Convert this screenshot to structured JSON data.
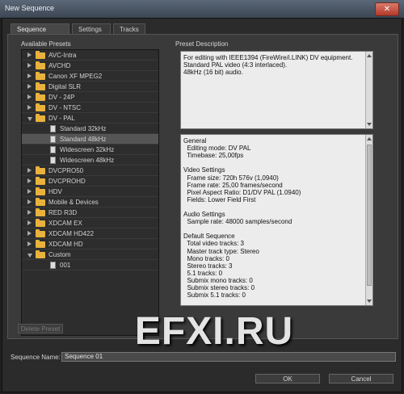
{
  "window": {
    "title": "New Sequence",
    "close_glyph": "✕"
  },
  "tabs": [
    "Sequence Presets",
    "Settings",
    "Tracks"
  ],
  "presets": {
    "group_label": "Available Presets",
    "items": [
      {
        "label": "AVC-Intra",
        "type": "folder",
        "expanded": false
      },
      {
        "label": "AVCHD",
        "type": "folder",
        "expanded": false
      },
      {
        "label": "Canon XF MPEG2",
        "type": "folder",
        "expanded": false
      },
      {
        "label": "Digital SLR",
        "type": "folder",
        "expanded": false
      },
      {
        "label": "DV - 24P",
        "type": "folder",
        "expanded": false
      },
      {
        "label": "DV - NTSC",
        "type": "folder",
        "expanded": false
      },
      {
        "label": "DV - PAL",
        "type": "folder",
        "expanded": true
      },
      {
        "label": "Standard 32kHz",
        "type": "preset"
      },
      {
        "label": "Standard 48kHz",
        "type": "preset",
        "selected": true
      },
      {
        "label": "Widescreen 32kHz",
        "type": "preset"
      },
      {
        "label": "Widescreen 48kHz",
        "type": "preset"
      },
      {
        "label": "DVCPRO50",
        "type": "folder",
        "expanded": false
      },
      {
        "label": "DVCPROHD",
        "type": "folder",
        "expanded": false
      },
      {
        "label": "HDV",
        "type": "folder",
        "expanded": false
      },
      {
        "label": "Mobile & Devices",
        "type": "folder",
        "expanded": false
      },
      {
        "label": "RED R3D",
        "type": "folder",
        "expanded": false
      },
      {
        "label": "XDCAM EX",
        "type": "folder",
        "expanded": false
      },
      {
        "label": "XDCAM HD422",
        "type": "folder",
        "expanded": false
      },
      {
        "label": "XDCAM HD",
        "type": "folder",
        "expanded": false
      },
      {
        "label": "Custom",
        "type": "folder",
        "expanded": true
      },
      {
        "label": "001",
        "type": "preset"
      }
    ]
  },
  "description": {
    "group_label": "Preset Description",
    "text": [
      "For editing with IEEE1394 (FireWire/i.LINK) DV equipment.",
      "Standard PAL video (4:3 interlaced).",
      "48kHz (16 bit) audio."
    ]
  },
  "details": {
    "lines": [
      "General",
      "  Editing mode: DV PAL",
      "  Timebase: 25,00fps",
      "",
      "Video Settings",
      "  Frame size: 720h 576v (1,0940)",
      "  Frame rate: 25,00 frames/second",
      "  Pixel Aspect Ratio: D1/DV PAL (1.0940)",
      "  Fields: Lower Field First",
      "",
      "Audio Settings",
      "  Sample rate: 48000 samples/second",
      "",
      "Default Sequence",
      "  Total video tracks: 3",
      "  Master track type: Stereo",
      "  Mono tracks: 0",
      "  Stereo tracks: 3",
      "  5.1 tracks: 0",
      "  Submix mono tracks: 0",
      "  Submix stereo tracks: 0",
      "  Submix 5.1 tracks: 0"
    ]
  },
  "buttons": {
    "delete_preset": "Delete Preset",
    "ok": "OK",
    "cancel": "Cancel"
  },
  "sequence_name": {
    "label": "Sequence Name:",
    "value": "Sequence 01"
  },
  "watermark": "EFXI.RU"
}
